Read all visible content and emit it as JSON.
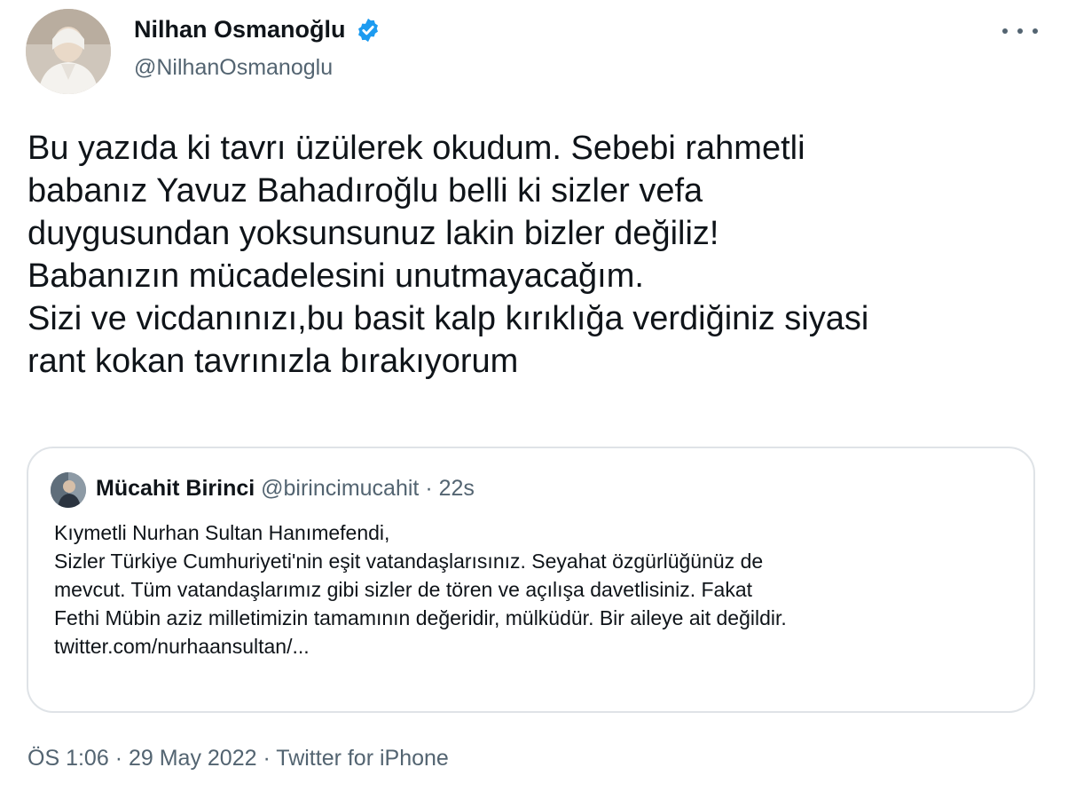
{
  "author": {
    "name": "Nilhan Osmanoğlu",
    "handle": "@NilhanOsmanoglu",
    "avatar_icon": "profile-photo",
    "verified_icon": "verified-badge-icon",
    "verified_color": "#1d9bf0"
  },
  "more_icon": "more-horizontal-icon",
  "tweet": {
    "lines": [
      "Bu yazıda ki tavrı üzülerek okudum. Sebebi rahmetli",
      "babanız Yavuz Bahadıroğlu belli ki sizler vefa",
      "duygusundan yoksunsunuz lakin bizler değiliz!",
      "Babanızın mücadelesini unutmayacağım.",
      "Sizi ve vicdanınızı,bu basit kalp kırıklığa verdiğiniz siyasi",
      "rant kokan tavrınızla bırakıyorum"
    ]
  },
  "quote": {
    "name": "Mücahit Birinci",
    "handle": "@birincimucahit",
    "separator": "·",
    "time": "22s",
    "lines": [
      "Kıymetli Nurhan Sultan Hanımefendi,",
      "Sizler Türkiye Cumhuriyeti'nin eşit vatandaşlarısınız. Seyahat özgürlüğünüz de",
      "mevcut. Tüm vatandaşlarımız gibi sizler de tören ve açılışa davetlisiniz. Fakat",
      "Fethi Mübin aziz milletimizin tamamının değeridir, mülküdür. Bir aileye ait değildir.",
      "twitter.com/nurhaansultan/..."
    ]
  },
  "meta": {
    "time": "ÖS 1:06",
    "sep1": "·",
    "date": "29 May 2022",
    "sep2": "·",
    "source": "Twitter for iPhone"
  },
  "colors": {
    "text": "#0f1419",
    "secondary": "#536471",
    "border": "#dfe3e7",
    "accent": "#1d9bf0"
  }
}
